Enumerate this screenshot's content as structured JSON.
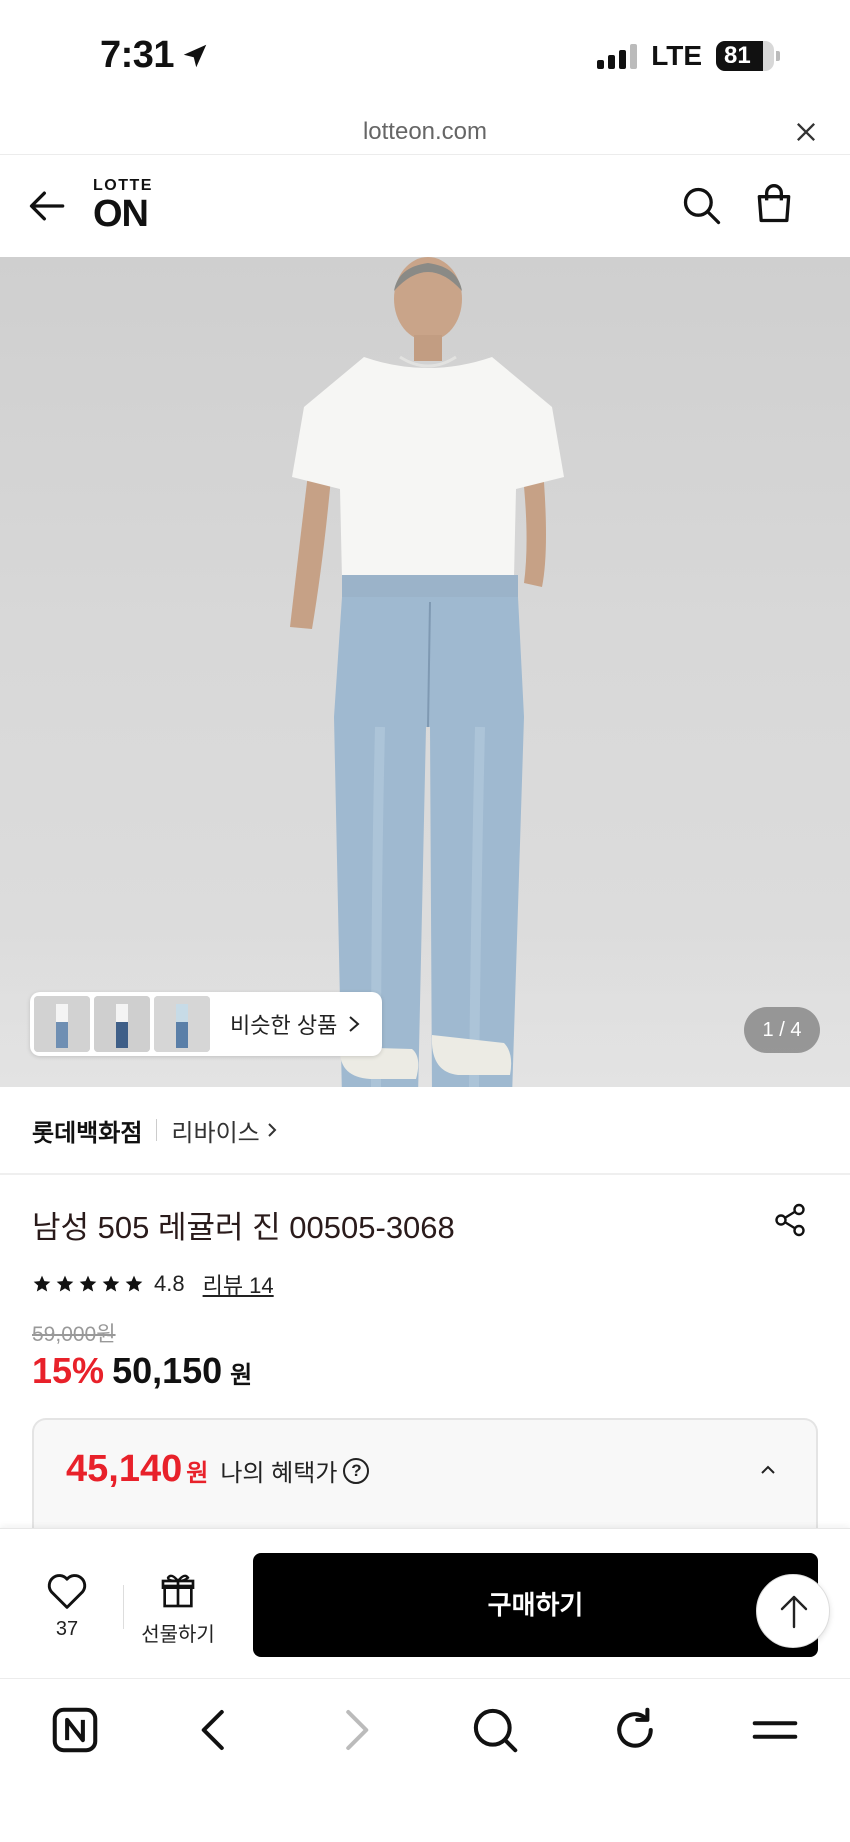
{
  "status_bar": {
    "time": "7:31",
    "network": "LTE",
    "battery": "81",
    "battery_level": 0.81
  },
  "browser": {
    "url": "lotteon.com"
  },
  "header": {
    "logo_top": "LOTTE",
    "logo_bottom": "ON"
  },
  "hero": {
    "similar_label": "비슷한 상품",
    "pager": "1 / 4"
  },
  "product": {
    "store": "롯데백화점",
    "brand": "리바이스",
    "title": "남성 505 레귤러 진 00505-3068",
    "rating": "4.8",
    "stars": 5,
    "review_label": "리뷰 14",
    "original_price": "59,000원",
    "discount": "15%",
    "sale_price": "50,150",
    "sale_unit": "원"
  },
  "benefit": {
    "price": "45,140",
    "unit": "원",
    "label": "나의 혜택가",
    "help": "?"
  },
  "purchase_bar": {
    "like_count": "37",
    "gift_label": "선물하기",
    "buy_label": "구매하기"
  },
  "colors": {
    "accent_red": "#e8212a",
    "buy_button": "#000000"
  },
  "toolbar_icons": [
    "naver-icon",
    "back-icon",
    "forward-icon",
    "search-icon",
    "refresh-icon",
    "menu-icon"
  ]
}
